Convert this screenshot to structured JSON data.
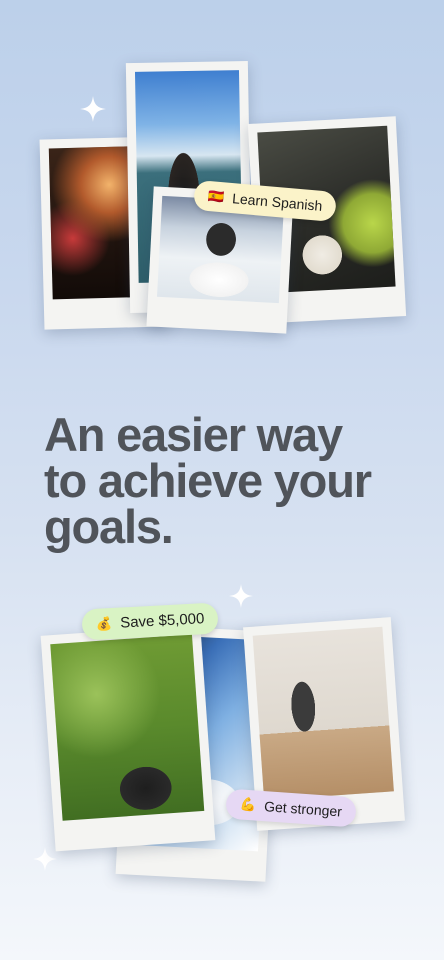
{
  "headline": {
    "line1": "An easier way",
    "line2": "to achieve your",
    "line3": "goals."
  },
  "chips": {
    "learn_spanish": {
      "emoji": "🇪🇸",
      "label": "Learn Spanish"
    },
    "save_money": {
      "emoji": "💰",
      "label": "Save $5,000"
    },
    "get_stronger": {
      "emoji": "💪",
      "label": "Get stronger"
    }
  },
  "colors": {
    "headline": "#50545a",
    "chip_learn": "#fbf3c9",
    "chip_save": "#d9f3c4",
    "chip_stronger": "#e6d8f4",
    "sparkle": "#ffffff"
  },
  "icons": {
    "sparkle": "sparkle-icon"
  }
}
